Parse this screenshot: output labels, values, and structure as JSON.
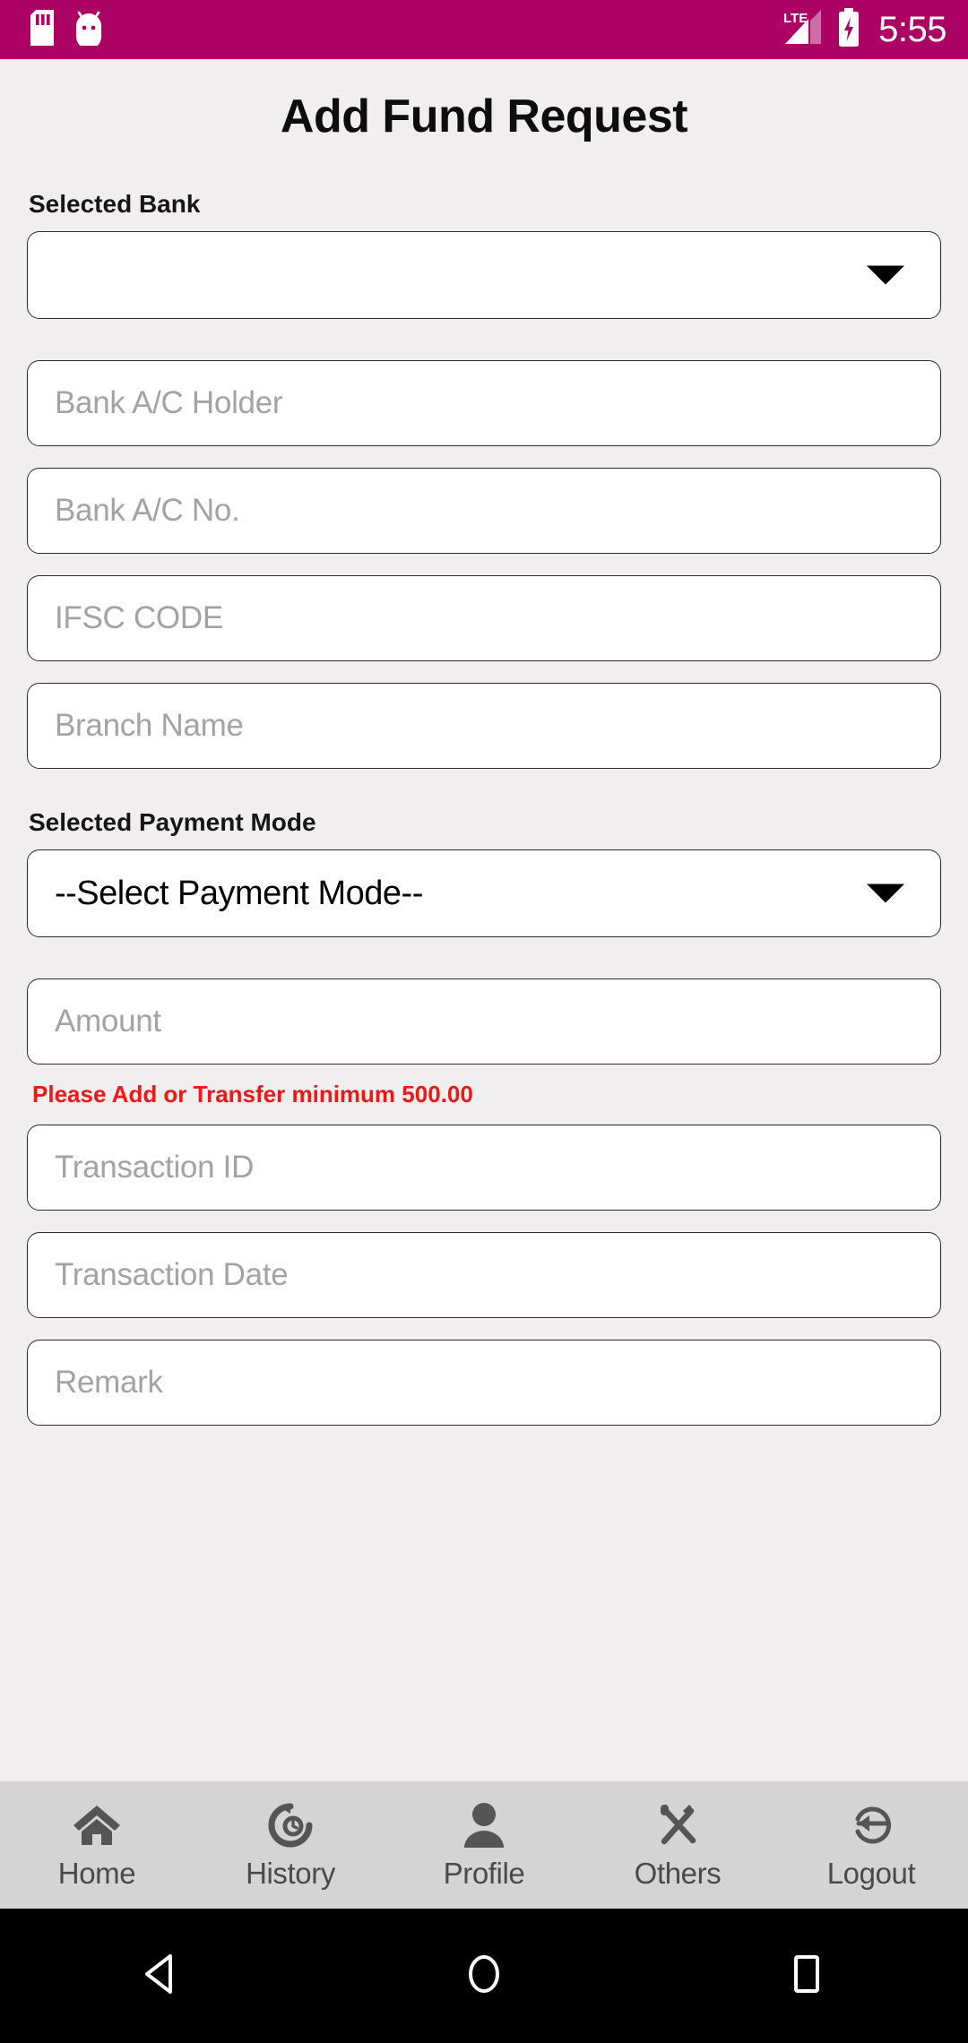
{
  "status_bar": {
    "background": "#ab0264",
    "time": "5:55",
    "icons": [
      "sd-card-icon",
      "android-robot-icon",
      "lte-signal-icon",
      "battery-charging-icon"
    ],
    "network_label": "LTE"
  },
  "header": {
    "title": "Add Fund Request"
  },
  "form": {
    "bank_label": "Selected Bank",
    "bank_select_value": "",
    "bank_ac_holder_placeholder": "Bank A/C Holder",
    "bank_ac_holder_value": "",
    "bank_ac_no_placeholder": "Bank A/C No.",
    "bank_ac_no_value": "",
    "ifsc_placeholder": "IFSC CODE",
    "ifsc_value": "",
    "branch_placeholder": "Branch Name",
    "branch_value": "",
    "payment_mode_label": "Selected Payment Mode",
    "payment_mode_value": "--Select Payment Mode--",
    "amount_placeholder": "Amount",
    "amount_value": "",
    "amount_error": "Please Add or Transfer minimum 500.00",
    "amount_error_color": "#f01717",
    "transaction_id_placeholder": "Transaction ID",
    "transaction_id_value": "",
    "transaction_date_placeholder": "Transaction Date",
    "transaction_date_value": "",
    "remark_placeholder": "Remark",
    "remark_value": ""
  },
  "tabbar": {
    "background": "#d4d4d4",
    "items": [
      {
        "label": "Home",
        "icon": "home-icon"
      },
      {
        "label": "History",
        "icon": "history-icon"
      },
      {
        "label": "Profile",
        "icon": "person-icon"
      },
      {
        "label": "Others",
        "icon": "tools-icon"
      },
      {
        "label": "Logout",
        "icon": "logout-icon"
      }
    ]
  },
  "navbar": {
    "buttons": [
      "back-triangle-icon",
      "home-circle-icon",
      "recents-square-icon"
    ]
  }
}
